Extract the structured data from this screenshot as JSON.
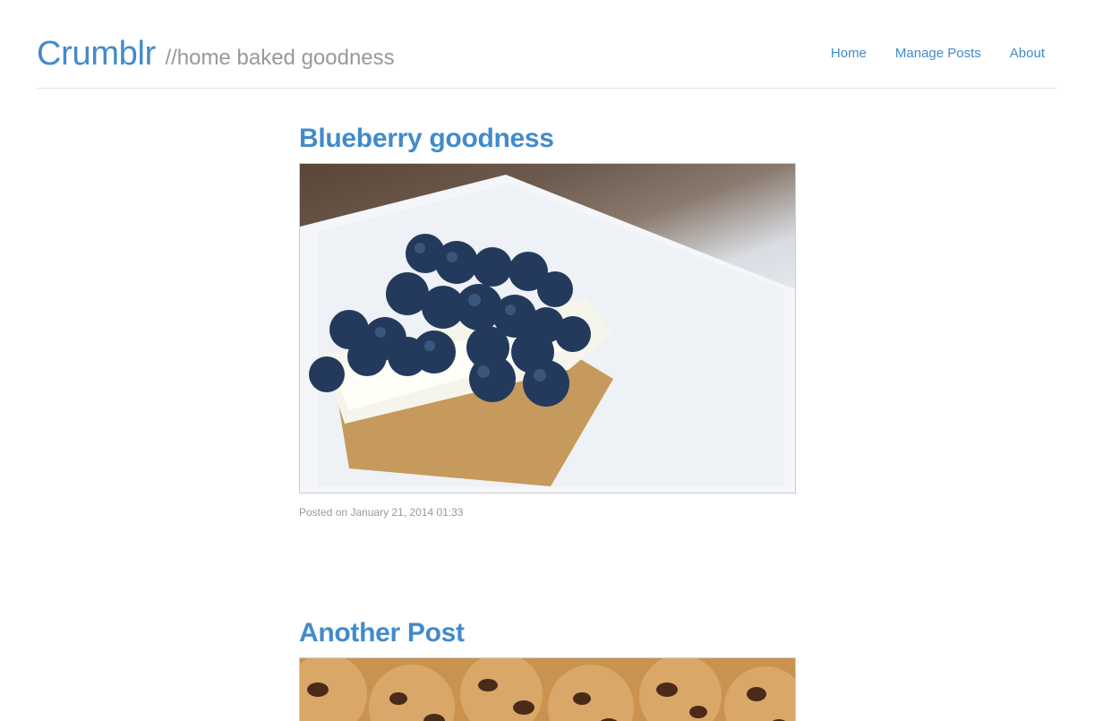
{
  "header": {
    "brand": "Crumblr",
    "tagline": "//home baked goodness",
    "nav": [
      {
        "label": "Home"
      },
      {
        "label": "Manage Posts"
      },
      {
        "label": "About"
      }
    ]
  },
  "posts": [
    {
      "title": "Blueberry goodness",
      "meta": "Posted on January 21, 2014 01:33"
    },
    {
      "title": "Another Post",
      "meta": ""
    }
  ],
  "colors": {
    "link": "#428bca",
    "muted": "#999999",
    "divider": "#e5e5e5"
  }
}
